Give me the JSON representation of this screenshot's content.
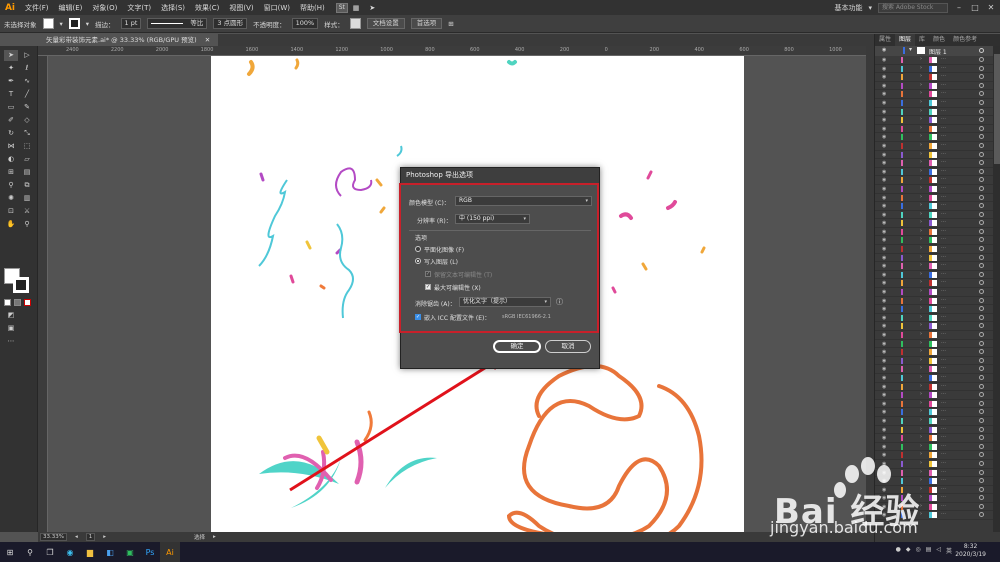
{
  "app": {
    "logo": "Ai"
  },
  "menu": {
    "items": [
      "文件(F)",
      "编辑(E)",
      "对象(O)",
      "文字(T)",
      "选择(S)",
      "效果(C)",
      "视图(V)",
      "窗口(W)",
      "帮助(H)"
    ],
    "badge": "St",
    "workspace": "基本功能",
    "search_placeholder": "搜索 Adobe Stock"
  },
  "control_bar": {
    "selection": "未选择对象",
    "stroke_label": "描边：",
    "stroke_weight": "1 pt",
    "stroke_style": "等比",
    "brush": "3 点圆形",
    "opacity_label": "不透明度：",
    "opacity_value": "100%",
    "style_label": "样式：",
    "doc_setup": "文档设置",
    "preferences": "首选项"
  },
  "document": {
    "tab_title": "矢量彩带装饰元素.ai* @ 33.33% (RGB/GPU 预览)",
    "ruler_ticks": [
      "2400",
      "2200",
      "2000",
      "1800",
      "1600",
      "1400",
      "1200",
      "1000",
      "800",
      "600",
      "400",
      "200",
      "0",
      "200",
      "400",
      "600",
      "800",
      "1000"
    ]
  },
  "status": {
    "zoom": "33.33%",
    "artboard": "1",
    "tool": "选择"
  },
  "panel": {
    "tabs": [
      "属性",
      "图层",
      "库",
      "颜色",
      "颜色参考"
    ],
    "active_tab": "图层",
    "top_layer": "图层 1"
  },
  "dialog": {
    "title": "Photoshop 导出选项",
    "color_model_label": "颜色模型 (C)：",
    "color_model_value": "RGB",
    "resolution_label": "分辨率 (R)：",
    "resolution_value": "中 (150 ppi)",
    "options_header": "选项",
    "flat_image": "平面化图像 (F)",
    "write_layers": "写入图层 (L)",
    "preserve_text": "保留文本可编辑性 (T)",
    "max_editability": "最大可编辑性 (X)",
    "antialias_label": "消除锯齿 (A)：",
    "antialias_value": "优化文字（提示）",
    "embed_icc": "嵌入 ICC 配置文件 (E)：",
    "icc_profile": "sRGB IEC61966-2.1",
    "ok": "确定",
    "cancel": "取消"
  },
  "taskbar": {
    "time": "8:32",
    "date": "2020/3/19",
    "lang": "英"
  },
  "watermark": {
    "text": "Bai 经验",
    "url": "jingyan.baidu.com"
  },
  "colors": {
    "highlight": "#c8202a",
    "arrow": "#e0121b",
    "ai_orange": "#ff9a00"
  }
}
